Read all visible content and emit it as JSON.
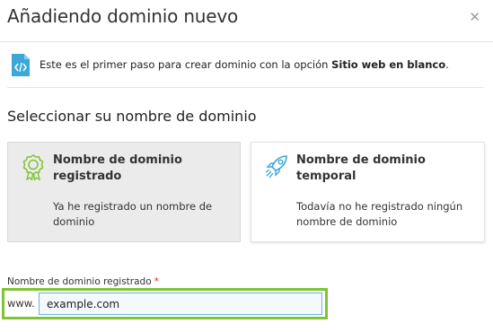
{
  "dialog": {
    "title": "Añadiendo dominio nuevo",
    "close_icon": "close-icon"
  },
  "info": {
    "icon": "code-file-icon",
    "text_prefix": "Este es el primer paso para crear dominio con la opción ",
    "text_bold": "Sitio web en blanco",
    "text_suffix": "."
  },
  "section": {
    "title": "Seleccionar su nombre de dominio"
  },
  "options": [
    {
      "icon": "certificate-badge-icon",
      "title": "Nombre de dominio registrado",
      "description": "Ya he registrado un nombre de dominio",
      "selected": true
    },
    {
      "icon": "rocket-icon",
      "title": "Nombre de dominio temporal",
      "description": "Todavía no he registrado ningún nombre de dominio",
      "selected": false
    }
  ],
  "field": {
    "label": "Nombre de dominio registrado",
    "required_mark": "*",
    "prefix": "www.",
    "value": "example.com"
  },
  "colors": {
    "highlight": "#7fc431",
    "icon_accent": "#3da7d8",
    "required": "#d02b2b"
  }
}
